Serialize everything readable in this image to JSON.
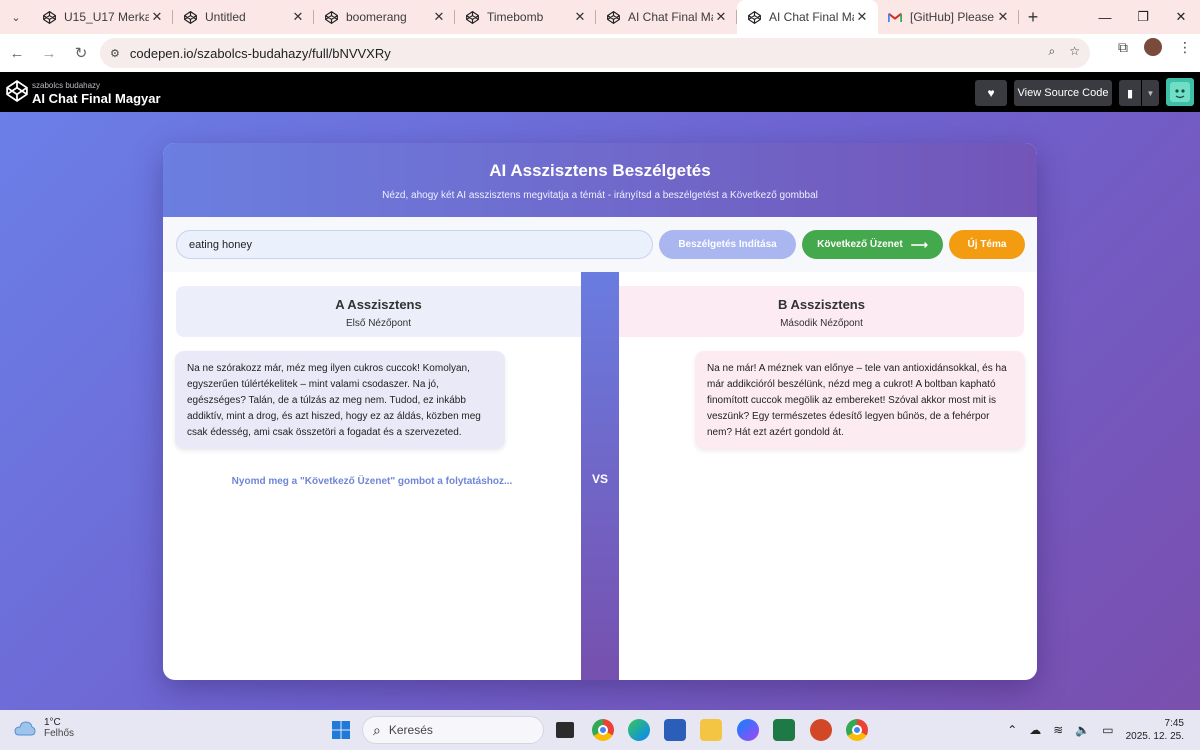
{
  "browser": {
    "tabs": [
      {
        "title": "U15_U17 Merkapt",
        "active": false
      },
      {
        "title": "Untitled",
        "active": false
      },
      {
        "title": "boomerang",
        "active": false
      },
      {
        "title": "Timebomb",
        "active": false
      },
      {
        "title": "AI Chat Final Mag",
        "active": false
      },
      {
        "title": "AI Chat Final Mag",
        "active": true
      },
      {
        "title": "[GitHub] Please ve",
        "active": false
      }
    ],
    "url": "codepen.io/szabolcs-budahazy/full/bNVVXRy"
  },
  "codepen": {
    "user": "szabolcs budahazy",
    "pen_title": "AI Chat Final Magyar",
    "view_source": "View Source Code"
  },
  "app": {
    "title": "AI Asszisztens Beszélgetés",
    "subtitle": "Nézd, ahogy két AI asszisztens megvitatja a témát - irányítsd a beszélgetést a Következő gombbal",
    "topic_value": "eating honey",
    "start_button": "Beszélgetés Indítása",
    "next_button": "Következő Üzenet",
    "new_topic_button": "Új Téma",
    "vs": "VS",
    "assistant_a": {
      "name": "A Asszisztens",
      "role": "Első Nézőpont",
      "message": "Na ne szórakozz már, méz meg ilyen cukros cuccok! Komolyan, egyszerűen túlértékelitek – mint valami csodaszer. Na jó, egészséges? Talán, de a túlzás az meg nem. Tudod, ez inkább addiktív, mint a drog, és azt hiszed, hogy ez az áldás, közben meg csak édesség, ami csak összetöri a fogadat és a szervezeted."
    },
    "assistant_b": {
      "name": "B Asszisztens",
      "role": "Második Nézőpont",
      "message": "Na ne már! A méznek van előnye – tele van antioxidánsokkal, és ha már addikcióról beszélünk, nézd meg a cukrot! A boltban kapható finomított cuccok megölik az embereket! Szóval akkor most mit is veszünk? Egy természetes édesítő legyen bűnös, de a fehérpor nem? Hát ezt azért gondold át."
    },
    "hint": "Nyomd meg a \"Következő Üzenet\" gombot a folytatáshoz..."
  },
  "taskbar": {
    "temperature": "1°C",
    "weather": "Felhős",
    "search_placeholder": "Keresés",
    "time": "7:45",
    "date": "2025. 12. 25."
  }
}
